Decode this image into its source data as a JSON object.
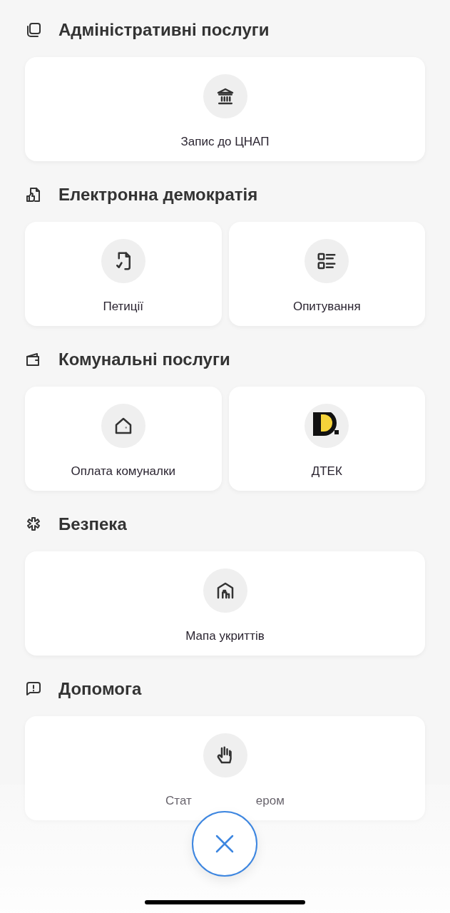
{
  "sections": [
    {
      "title": "Адміністративні послуги",
      "items": [
        {
          "label_parts": [
            "Запис до ЦНАП"
          ]
        }
      ]
    },
    {
      "title": "Електронна демократія",
      "items": [
        {
          "label_parts": [
            "Петиції"
          ]
        },
        {
          "label_parts": [
            "Опитування"
          ]
        }
      ]
    },
    {
      "title": "Комунальні послуги",
      "items": [
        {
          "label_parts": [
            "Оплата комуналки"
          ]
        },
        {
          "label_parts": [
            "ДТЕК"
          ]
        }
      ]
    },
    {
      "title": "Безпека",
      "items": [
        {
          "label_parts": [
            "Мапа укриттів"
          ]
        }
      ]
    },
    {
      "title": "Допомога",
      "items": [
        {
          "label_parts": [
            "Стат",
            "ером"
          ]
        }
      ]
    }
  ]
}
